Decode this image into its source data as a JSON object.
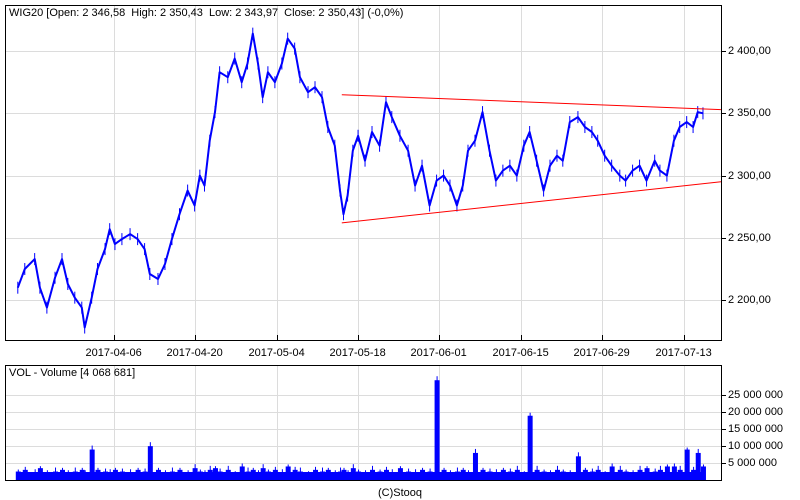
{
  "chart_data": [
    {
      "type": "line",
      "title": "WIG20 [Open: 2 346,58  High: 2 350,43  Low: 2 343,97  Close: 2 350,43] (-0,0%)",
      "x_unit": "days from 2017-04-06",
      "xlim": [
        -18.7,
        104.4
      ],
      "ylim": [
        2168,
        2437
      ],
      "grid": true,
      "y_ticks": [
        2200,
        2250,
        2300,
        2350,
        2400
      ],
      "y_tick_labels": [
        "2 200,00",
        "2 250,00",
        "2 300,00",
        "2 350,00",
        "2 400,00"
      ],
      "x_ticks": [
        0,
        14,
        28,
        42,
        56,
        70,
        84,
        98
      ],
      "x_tick_labels": [
        "2017-04-06",
        "2017-04-20",
        "2017-05-04",
        "2017-05-18",
        "2017-06-01",
        "2017-06-15",
        "2017-06-29",
        "2017-07-13"
      ],
      "series": [
        {
          "name": "WIG20",
          "color": "#0000ff",
          "x": [
            -16.5,
            -15.3,
            -13.6,
            -12.7,
            -11.5,
            -10.1,
            -8.9,
            -7.9,
            -6.7,
            -5.5,
            -5.0,
            -3.8,
            -2.8,
            -1.5,
            -0.7,
            0.2,
            1.4,
            2.8,
            4.1,
            5.3,
            6.2,
            7.6,
            8.8,
            10.0,
            11.3,
            12.7,
            13.9,
            14.8,
            15.6,
            16.5,
            17.4,
            18.2,
            19.6,
            20.8,
            22.0,
            23.0,
            23.9,
            24.8,
            25.6,
            26.5,
            27.7,
            28.9,
            29.9,
            31.1,
            32.0,
            33.4,
            34.6,
            35.8,
            36.8,
            38.0,
            38.9,
            39.5,
            40.2,
            41.1,
            42.0,
            43.2,
            44.4,
            45.7,
            46.8,
            47.8,
            49.2,
            50.6,
            51.8,
            53.0,
            54.3,
            55.5,
            56.7,
            57.8,
            59.0,
            60.0,
            60.9,
            62.1,
            63.4,
            64.6,
            65.7,
            66.9,
            68.1,
            69.3,
            70.5,
            71.5,
            72.7,
            73.9,
            75.0,
            76.2,
            77.2,
            78.4,
            79.8,
            81.0,
            82.2,
            83.2,
            84.4,
            85.6,
            87.0,
            88.0,
            89.2,
            90.4,
            91.6,
            93.0,
            93.9,
            95.1,
            96.3,
            97.3,
            98.5,
            99.6,
            100.4,
            101.3
          ],
          "values": [
            2210,
            2225,
            2233,
            2210,
            2194,
            2218,
            2233,
            2213,
            2202,
            2194,
            2178,
            2202,
            2225,
            2241,
            2257,
            2245,
            2249,
            2253,
            2249,
            2241,
            2221,
            2217,
            2229,
            2249,
            2269,
            2288,
            2276,
            2300,
            2292,
            2328,
            2351,
            2383,
            2379,
            2394,
            2375,
            2390,
            2414,
            2390,
            2363,
            2383,
            2375,
            2390,
            2410,
            2402,
            2379,
            2367,
            2371,
            2363,
            2339,
            2324,
            2288,
            2269,
            2284,
            2320,
            2332,
            2312,
            2335,
            2324,
            2359,
            2347,
            2332,
            2320,
            2292,
            2308,
            2276,
            2296,
            2300,
            2292,
            2276,
            2292,
            2320,
            2328,
            2351,
            2320,
            2296,
            2304,
            2308,
            2300,
            2324,
            2335,
            2312,
            2288,
            2308,
            2316,
            2312,
            2343,
            2347,
            2339,
            2335,
            2328,
            2316,
            2308,
            2300,
            2296,
            2304,
            2308,
            2296,
            2312,
            2304,
            2300,
            2328,
            2339,
            2343,
            2339,
            2351,
            2350
          ]
        },
        {
          "name": "upper-trendline",
          "color": "#ff0000",
          "x": [
            39.2,
            104.4
          ],
          "values": [
            2365,
            2353
          ]
        },
        {
          "name": "lower-trendline",
          "color": "#ff0000",
          "x": [
            39.2,
            104.4
          ],
          "values": [
            2262,
            2295
          ]
        }
      ]
    },
    {
      "type": "bar",
      "title": "VOL - Volume [4 068 681]",
      "ylabel": "Volume",
      "ylim": [
        0,
        34000000
      ],
      "grid": true,
      "y_ticks": [
        5000000,
        10000000,
        15000000,
        20000000,
        25000000
      ],
      "y_tick_labels": [
        "5 000 000",
        "10 000 000",
        "15 000 000",
        "20 000 000",
        "25 000 000"
      ],
      "color": "#0000ff",
      "series": [
        {
          "name": "Volume (millions)",
          "values": [
            2.5,
            3,
            2,
            3.5,
            2,
            2.5,
            3,
            2,
            2.5,
            3,
            2,
            9,
            3,
            2.5,
            2,
            3,
            2.5,
            2,
            3,
            2.5,
            10,
            3,
            2,
            2.5,
            3,
            2,
            3.5,
            2.5,
            2,
            3,
            3.5,
            2.5,
            3,
            2,
            4,
            2.5,
            3,
            2,
            3.5,
            2.5,
            3,
            2,
            4,
            3,
            2.5,
            2,
            3,
            2.5,
            3,
            2,
            2.5,
            3,
            2,
            3.5,
            2.5,
            2,
            3,
            2.5,
            3,
            2,
            3.5,
            2.5,
            2,
            3,
            2.5,
            29.5,
            3,
            2,
            2.5,
            3,
            2,
            8,
            3,
            2.5,
            2,
            3,
            2.5,
            3,
            2,
            19,
            3,
            2.5,
            2,
            3,
            2.5,
            2,
            7,
            3,
            2.5,
            3,
            2,
            4,
            3,
            2.5,
            2,
            3,
            3.5,
            2.5,
            3,
            4,
            4,
            3,
            9,
            3,
            8,
            4
          ]
        }
      ]
    }
  ],
  "footer": "(C)Stooq"
}
